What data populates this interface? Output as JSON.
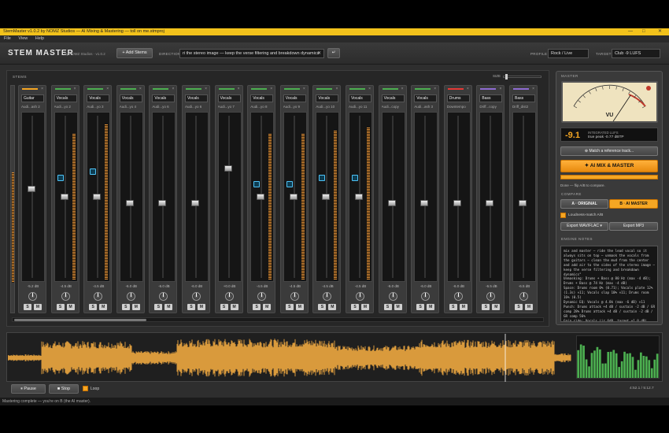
{
  "app": {
    "title": "StemMaster v1.0.2 by NOMZ Studios — AI Mixing & Mastering — toll on me.stmproj",
    "menu": [
      "File",
      "View",
      "Help"
    ],
    "window_controls": [
      "—",
      "□",
      "✕"
    ]
  },
  "toolbar": {
    "logo": "STEM MASTER",
    "logo_sub": "by NOMZ Studios · v1.0.2",
    "add_stems_label": "+ Add Stems",
    "direction_label": "DIRECTION",
    "direction_value": "ri the stereo image — keep the verse filtering and breakdown dynamics",
    "clear_icon": "✕",
    "go_icon": "↵",
    "profile_label": "PROFILE",
    "profile_value": "Rock / Live",
    "target_label": "TARGET",
    "target_value": "Club -9 LUFS"
  },
  "stems_panel": {
    "label": "STEMS",
    "size_label": "SIZE"
  },
  "channels": [
    {
      "name": "Guitar",
      "file": "Audi...ash 2",
      "color": "#f5a623",
      "db": "-5.2 dB",
      "fader": 0.55,
      "meter": 0.0,
      "ai": null
    },
    {
      "name": "Vocals",
      "file": "Audi...yo 2",
      "color": "#4caf50",
      "db": "-4.5 dB",
      "fader": 0.5,
      "meter": 0.88,
      "ai": 0.62
    },
    {
      "name": "Vocals",
      "file": "Audi...yo 3",
      "color": "#4caf50",
      "db": "-4.5 dB",
      "fader": 0.5,
      "meter": 0.94,
      "ai": 0.66
    },
    {
      "name": "Vocals",
      "file": "Audi...yo 4",
      "color": "#4caf50",
      "db": "-6.0 dB",
      "fader": 0.46,
      "meter": 0.0,
      "ai": null
    },
    {
      "name": "Vocals",
      "file": "Audi...yo 6",
      "color": "#4caf50",
      "db": "-6.0 dB",
      "fader": 0.46,
      "meter": 0.0,
      "ai": null
    },
    {
      "name": "Vocals",
      "file": "Audi...yo 6",
      "color": "#4caf50",
      "db": "-6.0 dB",
      "fader": 0.46,
      "meter": 0.0,
      "ai": null
    },
    {
      "name": "Vocals",
      "file": "Audi...yo 7",
      "color": "#4caf50",
      "db": "+0.0 dB",
      "fader": 0.68,
      "meter": 0.0,
      "ai": null
    },
    {
      "name": "Vocals",
      "file": "Audi...yo 8",
      "color": "#4caf50",
      "db": "-4.5 dB",
      "fader": 0.5,
      "meter": 0.88,
      "ai": 0.58
    },
    {
      "name": "Vocals",
      "file": "Audi...yo 9",
      "color": "#4caf50",
      "db": "-4.5 dB",
      "fader": 0.5,
      "meter": 0.88,
      "ai": 0.58
    },
    {
      "name": "Vocals",
      "file": "Audi...yo 10",
      "color": "#4caf50",
      "db": "-4.5 dB",
      "fader": 0.5,
      "meter": 0.9,
      "ai": 0.62
    },
    {
      "name": "Vocals",
      "file": "Audi...yo 11",
      "color": "#4caf50",
      "db": "-4.5 dB",
      "fader": 0.5,
      "meter": 0.92,
      "ai": 0.62
    },
    {
      "name": "Vocals",
      "file": "Audi...copy",
      "color": "#4caf50",
      "db": "-6.0 dB",
      "fader": 0.46,
      "meter": 0.0,
      "ai": null
    },
    {
      "name": "Vocals",
      "file": "Audi...ash 3",
      "color": "#4caf50",
      "db": "-6.0 dB",
      "fader": 0.46,
      "meter": 0.0,
      "ai": null
    },
    {
      "name": "Drums",
      "file": "Downtempo",
      "color": "#e53935",
      "db": "-6.0 dB",
      "fader": 0.46,
      "meter": 0.0,
      "ai": null
    },
    {
      "name": "Bass",
      "file": "Driff...copy",
      "color": "#8e6bd1",
      "db": "-6.5 dB",
      "fader": 0.46,
      "meter": 0.0,
      "ai": null
    },
    {
      "name": "Bass",
      "file": "Driff_dist2",
      "color": "#8e6bd1",
      "db": "-6.5 dB",
      "fader": 0.46,
      "meter": 0.0,
      "ai": null
    }
  ],
  "channel_buttons": {
    "solo": "S",
    "mute": "M"
  },
  "master": {
    "label": "MASTER",
    "vu_label": "VU",
    "vu_level": 0.78,
    "lufs_value": "-9.1",
    "lufs_label": "INTEGRATED LUFS",
    "true_peak": "true peak -0.77 dBTP",
    "match_ref_label": "⊕ Match a reference track...",
    "ai_button_label": "✦ AI  MIX & MASTER",
    "progress": 1.0,
    "status_text": "Done — flip A/B to compare.",
    "compare_label": "COMPARE",
    "compare_a": "A · ORIGINAL",
    "compare_b": "B · AI MASTER",
    "loudness_match": "Loudness-match A/B",
    "export_wav": "Export WAV/FLAC ▾",
    "export_mp3": "Export MP3",
    "notes_label": "ENGINE NOTES",
    "notes": "mix and master — ride the lead vocal so it always sits on top — unmask the vocals from the guitars — clean the mud from the center and add air to the sides of the stereo image — keep the verse filtering and breakdown dynamics\"\nUnmasking: Drums + Bass @ 80 Hz (max -4 dB); Drums + Bass @ 74 Hz (max -4 dB)\nSpace: Drums room 0% (0.71); Vocals plate 12% (1.3s) ×11; Vocals slap 10% ×11; Drums room 16% (0.5)\nDynamic EQ: Vocals @ 4.8k (max -6 dB) ×11\nPunch: Drums attack +4 dB / sustain -2 dB / GR comp 28% Drums attack +4 dB / sustain -2 dB / GR comp 56%\nGain ride: Vocals (ir 6dB, target +1.0 dB)"
  },
  "transport": {
    "pause_label": "⏸ Pause",
    "stop_label": "■ Stop",
    "loop_label": "Loop",
    "time": "4:52.1 / 5:12.7"
  },
  "statusbar": {
    "text": "Mastering complete — you're on B (the AI master)."
  },
  "colors": {
    "accent": "#f5a623",
    "ai_blue": "#4fc3f7",
    "waveform": "#d99a3c",
    "spectrum": "#4caf50"
  }
}
